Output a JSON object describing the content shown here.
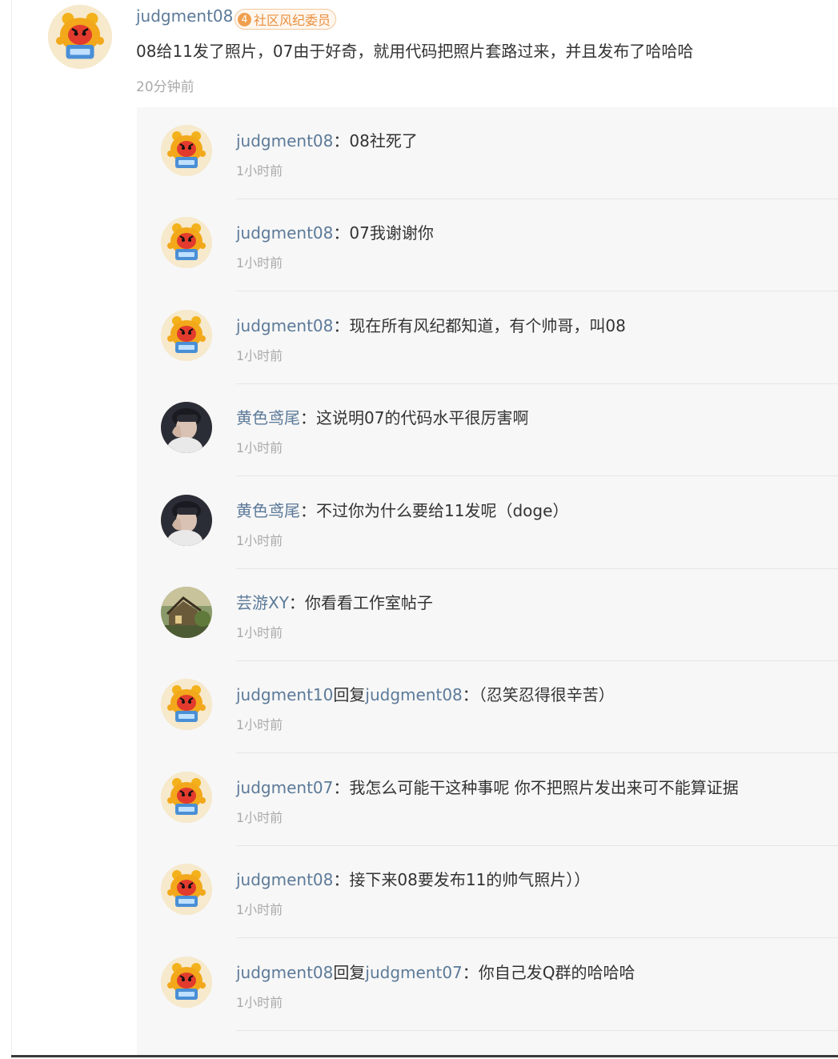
{
  "main_comment": {
    "username": "judgment08",
    "badge_level": "4",
    "badge_text": "社区风纪委员",
    "text": "08给11发了照片，07由于好奇，就用代码把照片套路过来，并且发布了哈哈哈",
    "time": "20分钟前"
  },
  "replies": [
    {
      "user": "judgment08",
      "reply_word": "",
      "target": "",
      "sep": "：",
      "text": "08社死了",
      "time": "1小时前",
      "avatar": "cartoon"
    },
    {
      "user": "judgment08",
      "reply_word": "",
      "target": "",
      "sep": "：",
      "text": "07我谢谢你",
      "time": "1小时前",
      "avatar": "cartoon"
    },
    {
      "user": "judgment08",
      "reply_word": "",
      "target": "",
      "sep": "：",
      "text": "现在所有风纪都知道，有个帅哥，叫08",
      "time": "1小时前",
      "avatar": "cartoon"
    },
    {
      "user": "黄色鸢尾",
      "reply_word": "",
      "target": "",
      "sep": "：",
      "text": "这说明07的代码水平很厉害啊",
      "time": "1小时前",
      "avatar": "person"
    },
    {
      "user": "黄色鸢尾",
      "reply_word": "",
      "target": "",
      "sep": "：",
      "text": "不过你为什么要给11发呢（doge）",
      "time": "1小时前",
      "avatar": "person"
    },
    {
      "user": "芸游XY",
      "reply_word": "",
      "target": "",
      "sep": "：",
      "text": "你看看工作室帖子",
      "time": "1小时前",
      "avatar": "scenery"
    },
    {
      "user": "judgment10",
      "reply_word": "回复",
      "target": "judgment08",
      "sep": "：",
      "text": "（忍笑忍得很辛苦）",
      "time": "1小时前",
      "avatar": "cartoon"
    },
    {
      "user": "judgment07",
      "reply_word": "",
      "target": "",
      "sep": "：",
      "text": "我怎么可能干这种事呢 你不把照片发出来可不能算证据",
      "time": "1小时前",
      "avatar": "cartoon"
    },
    {
      "user": "judgment08",
      "reply_word": "",
      "target": "",
      "sep": "：",
      "text": "接下来08要发布11的帅气照片））",
      "time": "1小时前",
      "avatar": "cartoon"
    },
    {
      "user": "judgment08",
      "reply_word": "回复",
      "target": "judgment07",
      "sep": "：",
      "text": "你自己发Q群的哈哈哈",
      "time": "1小时前",
      "avatar": "cartoon"
    }
  ]
}
